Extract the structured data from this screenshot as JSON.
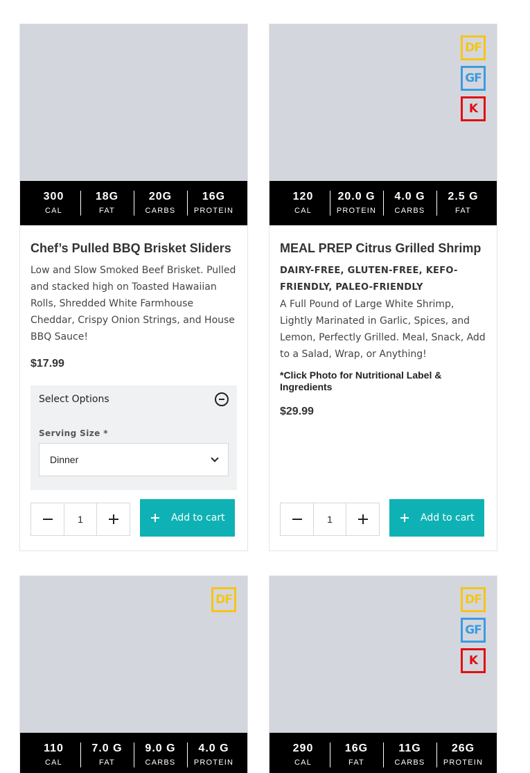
{
  "products": [
    {
      "badges": [],
      "nutrition": [
        {
          "value": "300",
          "label": "CAL"
        },
        {
          "value": "18G",
          "label": "FAT"
        },
        {
          "value": "20G",
          "label": "CARBS"
        },
        {
          "value": "16G",
          "label": "PROTEIN"
        }
      ],
      "title": "Chef’s Pulled BBQ Brisket Sliders",
      "description": "Low and Slow Smoked Beef Brisket. Pulled and stacked high on Toasted Hawaiian Rolls, Shredded White Farmhouse Cheddar, Crispy Onion Strings, and House BBQ Sauce!",
      "price": "$17.99",
      "options": {
        "title": "Select Options",
        "serving_label": "Serving Size  *",
        "serving_value": "Dinner"
      },
      "quantity": "1",
      "add_to_cart": "Add to cart"
    },
    {
      "badges": [
        "DF",
        "GF",
        "K"
      ],
      "nutrition": [
        {
          "value": "120",
          "label": "CAL"
        },
        {
          "value": "20.0 G",
          "label": "PROTEIN"
        },
        {
          "value": "4.0 G",
          "label": "CARBS"
        },
        {
          "value": "2.5 G",
          "label": "FAT"
        }
      ],
      "title": "MEAL PREP Citrus Grilled Shrimp",
      "tags": "DAIRY-FREE, GLUTEN-FREE, KEFO-FRIENDLY, PALEO-FRIENDLY",
      "description": "A Full Pound of Large White Shrimp, Lightly Marinated in Garlic, Spices, and Lemon, Perfectly Grilled. Meal, Snack, Add to a Salad, Wrap, or Anything!",
      "note": "*Click Photo for Nutritional Label & Ingredients",
      "price": "$29.99",
      "quantity": "1",
      "add_to_cart": "Add to cart"
    },
    {
      "badges": [
        "DF"
      ],
      "nutrition": [
        {
          "value": "110",
          "label": "CAL"
        },
        {
          "value": "7.0 G",
          "label": "FAT"
        },
        {
          "value": "9.0 G",
          "label": "CARBS"
        },
        {
          "value": "4.0 G",
          "label": "PROTEIN"
        }
      ]
    },
    {
      "badges": [
        "DF",
        "GF",
        "K"
      ],
      "nutrition": [
        {
          "value": "290",
          "label": "CAL"
        },
        {
          "value": "16G",
          "label": "FAT"
        },
        {
          "value": "11G",
          "label": "CARBS"
        },
        {
          "value": "26G",
          "label": "PROTEIN"
        }
      ]
    }
  ],
  "colors": {
    "accent": "#0fb2b4",
    "photo_placeholder": "#d4d6dd",
    "badge_df": "#f5c518",
    "badge_gf": "#3b9be0",
    "badge_k": "#e01010"
  }
}
